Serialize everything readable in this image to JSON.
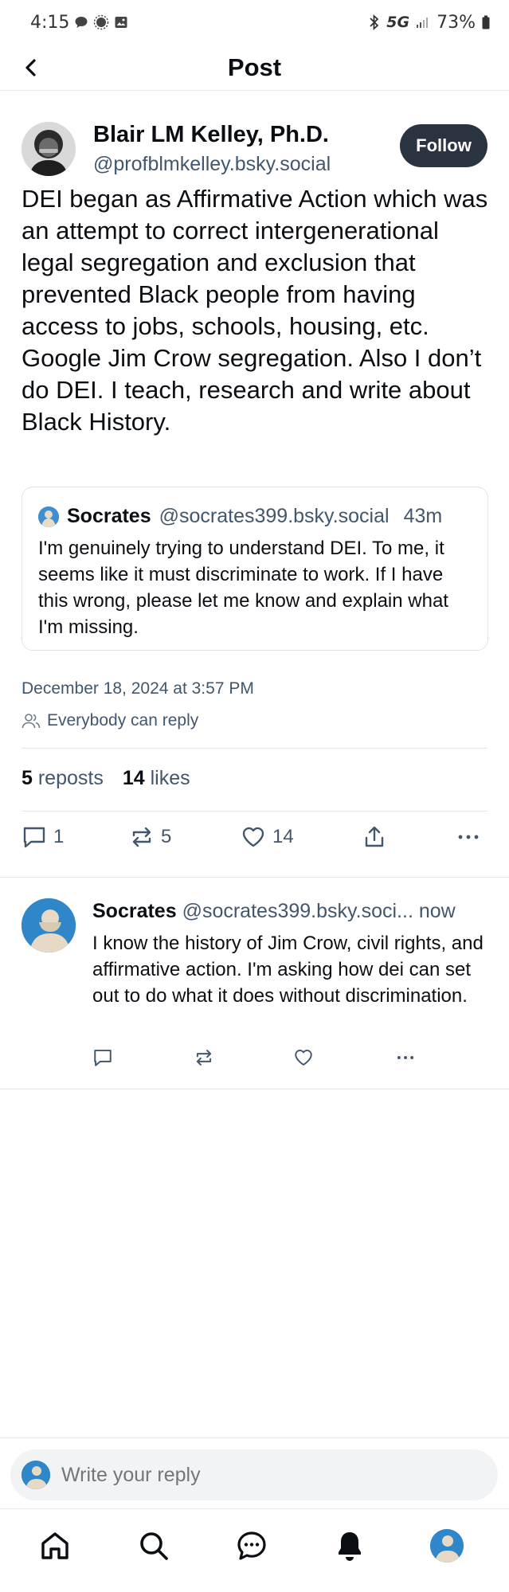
{
  "status_bar": {
    "time": "4:15",
    "network": "5G",
    "battery": "73%"
  },
  "header": {
    "title": "Post"
  },
  "post": {
    "author_name": "Blair LM Kelley, Ph.D.",
    "author_handle": "@profblmkelley.bsky.social",
    "follow_label": "Follow",
    "text": "DEI began as Affirmative Action which was an attempt to correct intergenerational legal segregation and exclusion that prevented Black people from having access to jobs, schools, housing, etc. Google Jim Crow segregation. Also I don’t do DEI. I teach, research and write about Black History.",
    "quote": {
      "author_name": "Socrates",
      "author_handle": "@socrates399.bsky.social",
      "time": "43m",
      "text": "I'm genuinely trying to understand DEI. To me, it seems like it must discriminate to work. If I have this wrong, please let me know and explain what I'm missing."
    },
    "date": "December 18, 2024 at 3:57 PM",
    "reply_setting": "Everybody can reply",
    "reposts_count": "5",
    "reposts_label": "reposts",
    "likes_count": "14",
    "likes_label": "likes",
    "actions": {
      "replies": "1",
      "reposts": "5",
      "likes": "14"
    }
  },
  "reply": {
    "author_name": "Socrates",
    "author_handle": "@socrates399.bsky.soci...",
    "time": "now",
    "text": "I know the history of Jim Crow, civil rights, and affirmative action. I'm asking how dei can set out to do what it does without discrimination."
  },
  "composer": {
    "placeholder": "Write your reply"
  },
  "tabs": [
    "home-icon",
    "search-icon",
    "chat-icon",
    "notifications-icon",
    "profile-avatar"
  ],
  "colors": {
    "follow_bg": "#2a3441",
    "muted_text": "#42576c",
    "divider": "#e3e6ea"
  }
}
